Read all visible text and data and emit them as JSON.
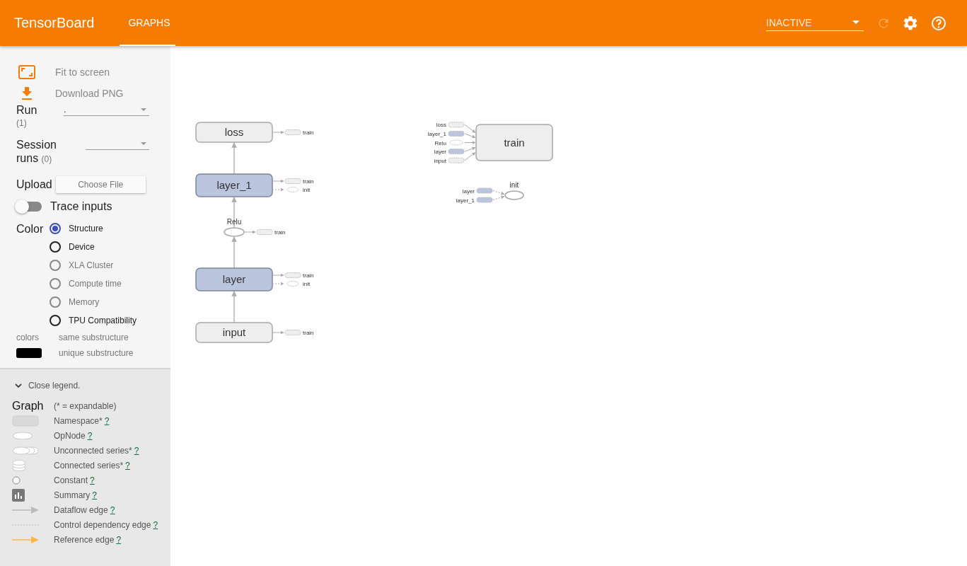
{
  "header": {
    "title": "TensorBoard",
    "tabs": [
      {
        "label": "GRAPHS",
        "selected": true
      }
    ],
    "status_select": {
      "value": "INACTIVE"
    },
    "reload": {
      "disabled": true
    }
  },
  "sidebar": {
    "actions": [
      {
        "kind": "fit",
        "label": "Fit to screen"
      },
      {
        "kind": "download",
        "label": "Download PNG"
      }
    ],
    "run": {
      "label": "Run",
      "count": "(1)",
      "value": "."
    },
    "session_runs": {
      "label": "Session runs",
      "count": "(0)"
    },
    "upload": {
      "label": "Upload",
      "button": "Choose File"
    },
    "trace_inputs": {
      "label": "Trace inputs",
      "on": false
    },
    "color": {
      "label": "Color",
      "options": [
        {
          "label": "Structure",
          "selected": true,
          "disabled": false
        },
        {
          "label": "Device",
          "selected": false,
          "disabled": false
        },
        {
          "label": "XLA Cluster",
          "selected": false,
          "disabled": true
        },
        {
          "label": "Compute time",
          "selected": false,
          "disabled": true
        },
        {
          "label": "Memory",
          "selected": false,
          "disabled": true
        },
        {
          "label": "TPU Compatibility",
          "selected": false,
          "disabled": false
        }
      ]
    },
    "colors_legend": {
      "label": "colors",
      "items": [
        "same substructure",
        "unique substructure"
      ]
    }
  },
  "legend": {
    "toggle": "Close legend.",
    "title": "Graph",
    "note": "(* = expandable)",
    "items": [
      {
        "kind": "namespace",
        "label": "Namespace*",
        "help": "?"
      },
      {
        "kind": "opnode",
        "label": "OpNode",
        "help": "?"
      },
      {
        "kind": "unconnected",
        "label": "Unconnected series*",
        "help": "?"
      },
      {
        "kind": "connected",
        "label": "Connected series*",
        "help": "?"
      },
      {
        "kind": "constant",
        "label": "Constant",
        "help": "?"
      },
      {
        "kind": "summary",
        "label": "Summary",
        "help": "?"
      },
      {
        "kind": "dataflow",
        "label": "Dataflow edge",
        "help": "?"
      },
      {
        "kind": "control",
        "label": "Control dependency edge",
        "help": "?"
      },
      {
        "kind": "reference",
        "label": "Reference edge",
        "help": "?"
      }
    ]
  },
  "graph": {
    "nodes": [
      {
        "name": "loss",
        "kind": "namespace",
        "color": "#eeeeee",
        "outputs": [
          {
            "label": "train",
            "control": false,
            "kind": "namespace",
            "color": "#eeeeee"
          }
        ]
      },
      {
        "name": "layer_1",
        "kind": "namespace",
        "color": "#bbc5de",
        "outputs": [
          {
            "label": "train",
            "control": false,
            "kind": "namespace",
            "color": "#eeeeee"
          },
          {
            "label": "init",
            "control": true,
            "kind": "op"
          }
        ]
      },
      {
        "name": "Relu",
        "kind": "op",
        "outputs": [
          {
            "label": "train",
            "control": false,
            "kind": "namespace",
            "color": "#eeeeee"
          }
        ]
      },
      {
        "name": "layer",
        "kind": "namespace",
        "color": "#bbc5de",
        "outputs": [
          {
            "label": "train",
            "control": false,
            "kind": "namespace",
            "color": "#eeeeee"
          },
          {
            "label": "init",
            "control": true,
            "kind": "op"
          }
        ]
      },
      {
        "name": "input",
        "kind": "namespace",
        "color": "#eeeeee",
        "outputs": [
          {
            "label": "train",
            "control": false,
            "kind": "namespace",
            "color": "#eeeeee"
          }
        ]
      },
      {
        "name": "train",
        "kind": "namespace",
        "color": "#eeeeee",
        "inputs": [
          {
            "label": "loss",
            "control": false,
            "kind": "namespace",
            "color": "#eeeeee"
          },
          {
            "label": "layer_1",
            "control": false,
            "kind": "namespace",
            "color": "#bbc5de"
          },
          {
            "label": "Relu",
            "control": false,
            "kind": "op"
          },
          {
            "label": "layer",
            "control": false,
            "kind": "namespace",
            "color": "#bbc5de"
          },
          {
            "label": "input",
            "control": false,
            "kind": "namespace",
            "color": "#eeeeee"
          }
        ]
      },
      {
        "name": "init",
        "kind": "op",
        "inputs": [
          {
            "label": "layer",
            "control": true,
            "kind": "namespace",
            "color": "#bbc5de"
          },
          {
            "label": "layer_1",
            "control": true,
            "kind": "namespace",
            "color": "#bbc5de"
          }
        ]
      }
    ]
  }
}
